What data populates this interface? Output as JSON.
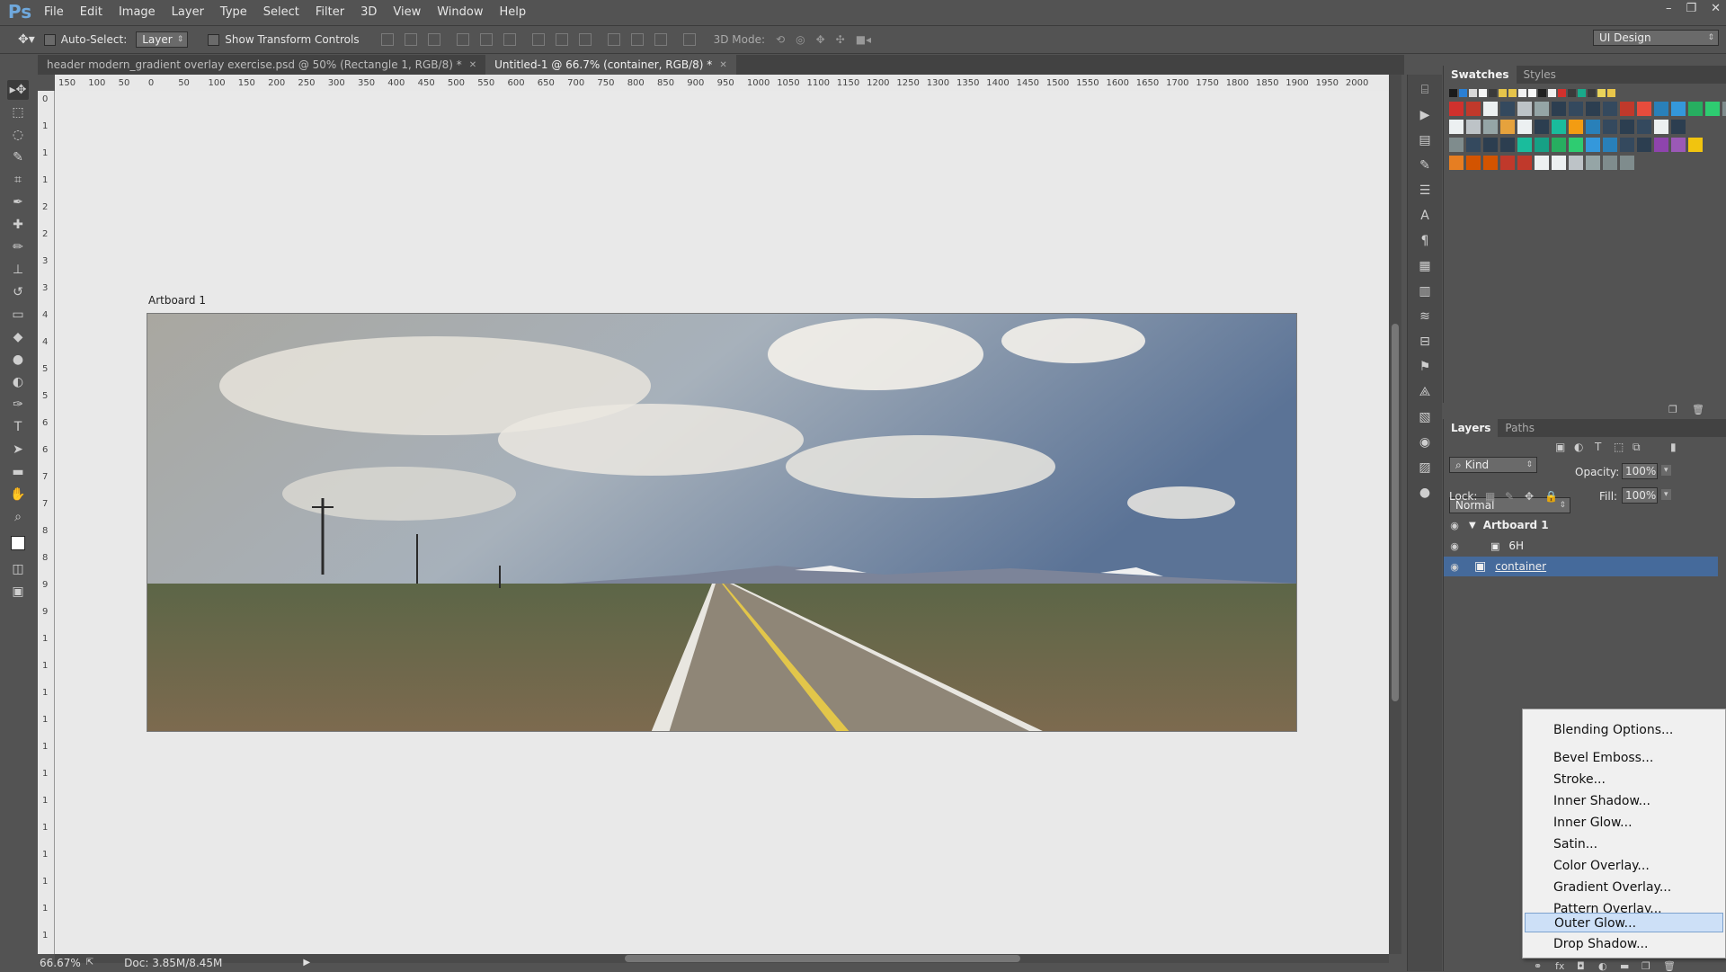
{
  "app": {
    "logo": "Ps"
  },
  "menu": [
    "File",
    "Edit",
    "Image",
    "Layer",
    "Type",
    "Select",
    "Filter",
    "3D",
    "View",
    "Window",
    "Help"
  ],
  "window_controls": {
    "minimize": "–",
    "restore": "❐",
    "close": "✕"
  },
  "options_bar": {
    "auto_select_label": "Auto-Select:",
    "auto_select_value": "Layer",
    "show_transform_label": "Show Transform Controls",
    "mode_3d_label": "3D Mode:",
    "workspace": "UI Design"
  },
  "tabs": [
    {
      "label": "header modern_gradient overlay exercise.psd @ 50% (Rectangle 1, RGB/8) *",
      "active": false
    },
    {
      "label": "Untitled-1 @ 66.7% (container, RGB/8) *",
      "active": true
    }
  ],
  "ruler_top": [
    "150",
    "100",
    "50",
    "0",
    "50",
    "100",
    "150",
    "200",
    "250",
    "300",
    "350",
    "400",
    "450",
    "500",
    "550",
    "600",
    "650",
    "700",
    "750",
    "800",
    "850",
    "900",
    "950",
    "1000",
    "1050",
    "1100",
    "1150",
    "1200",
    "1250",
    "1300",
    "1350",
    "1400",
    "1450",
    "1500",
    "1550",
    "1600",
    "1650",
    "1700",
    "1750",
    "1800",
    "1850",
    "1900",
    "1950",
    "2000"
  ],
  "ruler_left": [
    "0",
    "1",
    "1",
    "1",
    "2",
    "2",
    "3",
    "3",
    "4",
    "4",
    "5",
    "5",
    "6",
    "6",
    "7",
    "7",
    "8",
    "8",
    "9",
    "9",
    "1",
    "1",
    "1",
    "1",
    "1",
    "1",
    "1",
    "1",
    "1",
    "1",
    "1",
    "1"
  ],
  "canvas": {
    "artboard_label": "Artboard 1"
  },
  "status": {
    "zoom": "66.67%",
    "doc": "Doc: 3.85M/8.45M"
  },
  "swatches_panel": {
    "tabs": [
      "Swatches",
      "Styles"
    ]
  },
  "swatch_colors": [
    [
      "#1b1b1b",
      "#2a7fd4",
      "#d9d9d9",
      "#f5f5f5",
      "#3a3a3a",
      "#e6c44a",
      "#e6c44a",
      "#f0f0f0",
      "#f7f7f7",
      "#202020",
      "#f0f0f0",
      "#d0312d",
      "#3a3a3a",
      "#1aa98a",
      "#3a3a3a",
      "#e9d35a",
      "#e9c54a"
    ],
    [
      "#d0312d",
      "#c0392b",
      "#ecf0f1",
      "#34495e",
      "#bdc3c7",
      "#95a5a6",
      "#2c3e50",
      "#34495e",
      "#2c3e50",
      "#34495e",
      "#c0392b",
      "#e74c3c",
      "#2980b9",
      "#3498db",
      "#27ae60",
      "#2ecc71",
      "#7f8c8d"
    ],
    [
      "#ecf0f1",
      "#bdc3c7",
      "#95a5a6",
      "#e6a23c",
      "#ecf0f1",
      "#2c3e50",
      "#1abc9c",
      "#f39c12",
      "#2980b9",
      "#34495e",
      "#2c3e50",
      "#34495e",
      "#ecf0f1",
      "#2c3e50"
    ],
    [
      "#7f8c8d",
      "#34495e",
      "#2c3e50",
      "#2c3e50",
      "#1abc9c",
      "#16a085",
      "#27ae60",
      "#2ecc71",
      "#3498db",
      "#2980b9",
      "#34495e",
      "#2c3e50",
      "#8e44ad",
      "#9b59b6",
      "#f1c40f"
    ],
    [
      "#e67e22",
      "#d35400",
      "#d35400",
      "#c0392b",
      "#c0392b",
      "#ecf0f1",
      "#ecf0f1",
      "#bdc3c7",
      "#95a5a6",
      "#7f8c8d",
      "#7f8c8d"
    ]
  ],
  "layers_panel": {
    "tabs": [
      "Layers",
      "Paths"
    ],
    "kind": "Kind",
    "blend_mode": "Normal",
    "opacity_label": "Opacity:",
    "opacity_value": "100%",
    "lock_label": "Lock:",
    "fill_label": "Fill:",
    "fill_value": "100%",
    "layers": [
      {
        "name": "Artboard 1",
        "group": true
      },
      {
        "name": "6H",
        "group": false
      },
      {
        "name": "container",
        "group": false,
        "selected": true
      }
    ]
  },
  "context_menu": {
    "items": [
      "Blending Options...",
      "Bevel  Emboss...",
      "Stroke...",
      "Inner Shadow...",
      "Inner Glow...",
      "Satin...",
      "Color Overlay...",
      "Gradient Overlay...",
      "Pattern Overlay...",
      "Outer Glow...",
      "Drop Shadow..."
    ],
    "highlighted": "Outer Glow..."
  }
}
